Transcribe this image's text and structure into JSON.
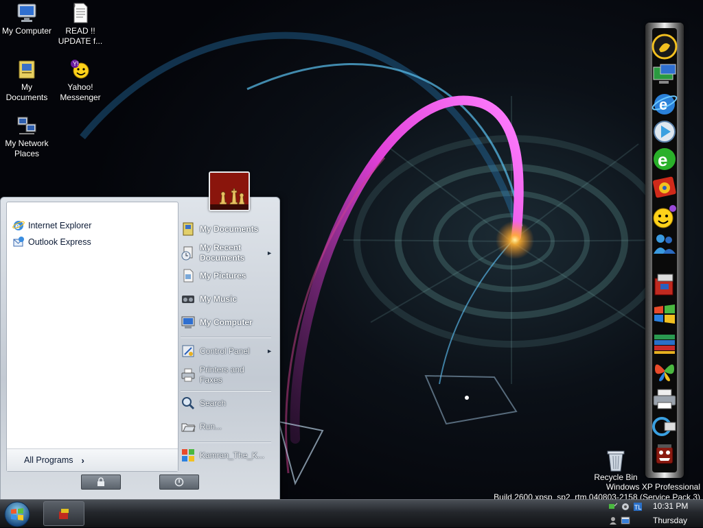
{
  "desktop": {
    "icons": [
      {
        "label": "My Computer"
      },
      {
        "label": "READ !!\nUPDATE f..."
      },
      {
        "label": "My\nDocuments"
      },
      {
        "label": "Yahoo!\nMessenger"
      },
      {
        "label": "My Network\nPlaces"
      }
    ],
    "recycle_bin": {
      "label": "Recycle Bin"
    },
    "watermark": {
      "line1": "Windows XP Professional",
      "line2": "Build 2600.xpsp_sp2_rtm.040803-2158 (Service Pack 3)"
    }
  },
  "start_menu": {
    "pinned": [
      {
        "label": "Internet Explorer",
        "icon": "internet-explorer-icon"
      },
      {
        "label": "Outlook Express",
        "icon": "outlook-express-icon"
      }
    ],
    "all_programs": {
      "label": "All Programs",
      "arrow": "›"
    },
    "right_items": [
      {
        "label": "My Documents",
        "bold": true
      },
      {
        "label": "My Recent\nDocuments",
        "bold": true,
        "submenu": "►"
      },
      {
        "label": "My Pictures",
        "bold": true
      },
      {
        "label": "My Music",
        "bold": true
      },
      {
        "label": "My Computer",
        "bold": true
      },
      {
        "label": "Control Panel",
        "bold": false,
        "submenu": "►"
      },
      {
        "label": "Printers and\nFaxes",
        "bold": false
      },
      {
        "label": "Search",
        "bold": false
      },
      {
        "label": "Run...",
        "bold": false
      },
      {
        "label": "Kamran_The_K...",
        "bold": false
      }
    ]
  },
  "taskbar": {
    "clock_time": "10:31 PM",
    "clock_day": "Thursday"
  },
  "colors": {
    "wallpaper_base": "#05060c",
    "arc_magenta": "#e040d8",
    "arc_cyan": "#3aa8e8",
    "glow": "#ffc040"
  }
}
